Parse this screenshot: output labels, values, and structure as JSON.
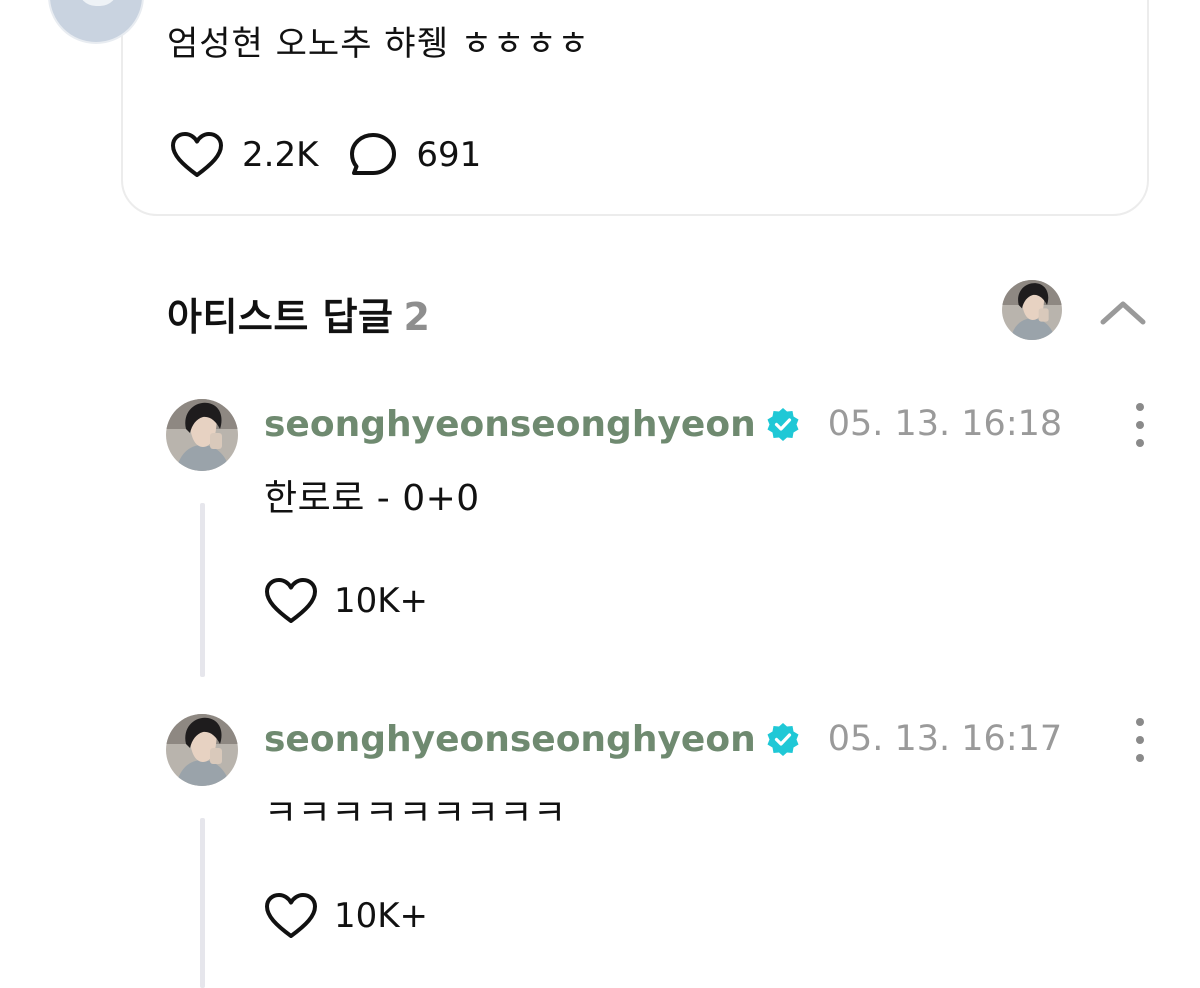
{
  "post": {
    "text": "엄성현 오노추 햐쥉 ㅎㅎㅎㅎ",
    "likes": "2.2K",
    "comments": "691"
  },
  "artist_replies": {
    "title": "아티스트 답글",
    "count": "2"
  },
  "replies": [
    {
      "username": "seonghyeonseonghyeon",
      "timestamp": "05. 13. 16:18",
      "text": "한로로 - 0+0",
      "likes": "10K+"
    },
    {
      "username": "seonghyeonseonghyeon",
      "timestamp": "05. 13. 16:17",
      "text": "ㅋㅋㅋㅋㅋㅋㅋㅋㅋ",
      "likes": "10K+"
    }
  ],
  "colors": {
    "username": "#6f8a70",
    "verified_badge": "#1fc8d6",
    "muted": "#9a9a9a",
    "card_border": "#ececec",
    "thread_line": "#e6e6ec"
  },
  "icons": {
    "like": "heart-icon",
    "comment": "comment-bubble-icon",
    "verified": "verified-badge-icon",
    "collapse": "chevron-up-icon",
    "more": "more-vertical-icon"
  }
}
